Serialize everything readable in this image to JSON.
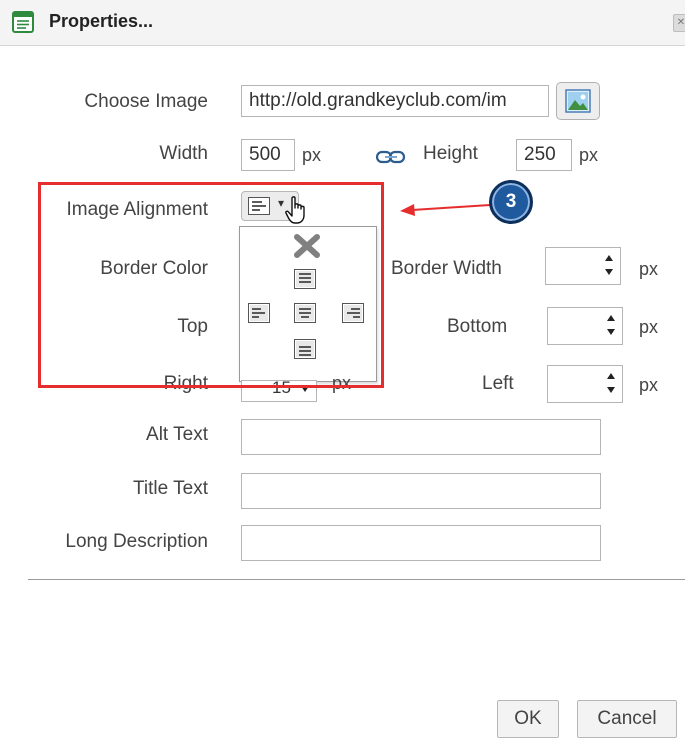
{
  "dialog": {
    "title": "Properties..."
  },
  "form": {
    "choose_image": {
      "label": "Choose Image",
      "value": "http://old.grandkeyclub.com/im"
    },
    "width": {
      "label": "Width",
      "value": "500",
      "unit": "px"
    },
    "height": {
      "label": "Height",
      "value": "250",
      "unit": "px"
    },
    "image_alignment": {
      "label": "Image Alignment"
    },
    "border_color": {
      "label": "Border Color"
    },
    "border_width": {
      "label": "Border Width",
      "value": "",
      "unit": "px"
    },
    "top": {
      "label": "Top"
    },
    "bottom": {
      "label": "Bottom",
      "value": "",
      "unit": "px"
    },
    "right": {
      "label": "Right",
      "value": "15",
      "unit": "px"
    },
    "left": {
      "label": "Left",
      "value": "",
      "unit": "px"
    },
    "alt_text": {
      "label": "Alt Text",
      "value": ""
    },
    "title_text": {
      "label": "Title Text",
      "value": ""
    },
    "long_description": {
      "label": "Long Description",
      "value": ""
    }
  },
  "annotation": {
    "step_number": "3",
    "highlight_color": "#e52d2d",
    "badge_color": "#1f5a9e"
  },
  "buttons": {
    "ok": "OK",
    "cancel": "Cancel"
  }
}
